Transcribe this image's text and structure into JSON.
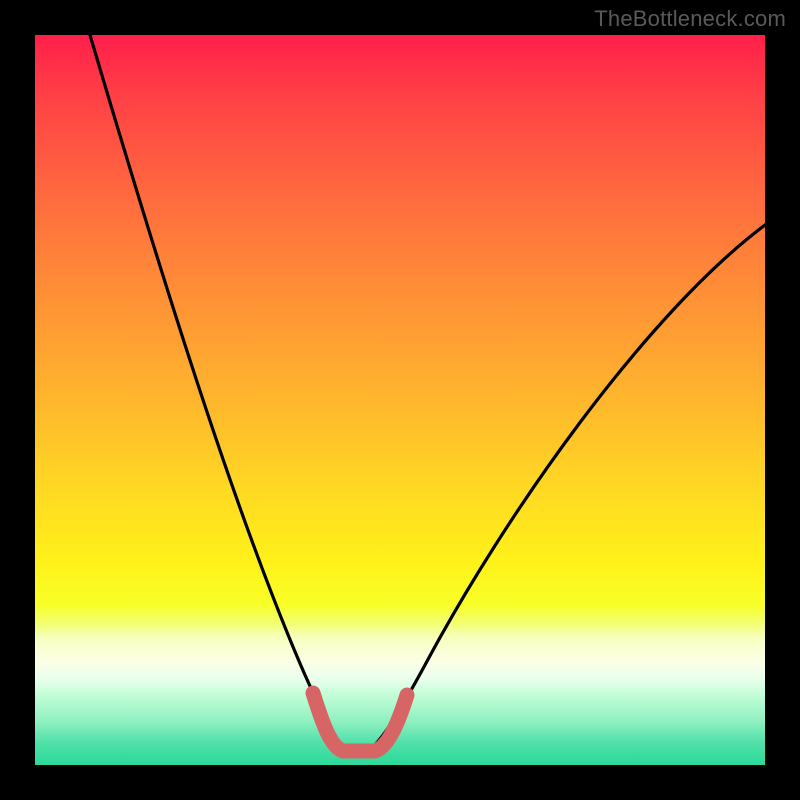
{
  "watermark": "TheBottleneck.com",
  "chart_data": {
    "type": "line",
    "title": "",
    "xlabel": "",
    "ylabel": "",
    "xlim": [
      0,
      100
    ],
    "ylim": [
      0,
      100
    ],
    "series": [
      {
        "name": "bottleneck-curve",
        "x": [
          5,
          10,
          15,
          20,
          25,
          30,
          35,
          38,
          40,
          42,
          44,
          46,
          48,
          52,
          60,
          70,
          80,
          90,
          100
        ],
        "y": [
          100,
          88,
          76,
          64,
          52,
          38,
          22,
          10,
          3,
          0,
          0,
          0,
          3,
          12,
          28,
          44,
          56,
          66,
          72
        ]
      }
    ],
    "highlight": {
      "name": "optimal-range",
      "x": [
        38,
        40,
        41,
        42,
        43,
        44,
        45,
        46,
        47,
        48,
        49
      ],
      "y": [
        9,
        3,
        1,
        0,
        0,
        0,
        0,
        0,
        1,
        3,
        8
      ]
    },
    "colors": {
      "gradient_top": "#ff1f4a",
      "gradient_mid": "#ffe020",
      "gradient_bottom": "#2bd99a",
      "curve": "#000000",
      "highlight": "#d85a5a"
    }
  }
}
